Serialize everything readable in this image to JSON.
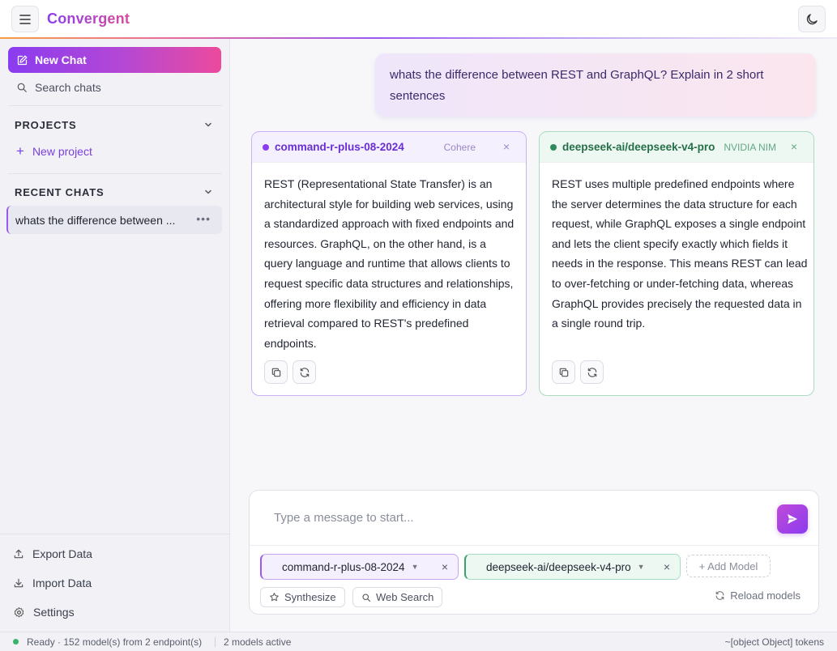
{
  "app": {
    "title": "Convergent"
  },
  "sidebar": {
    "new_chat": "New Chat",
    "search": "Search chats",
    "projects_title": "PROJECTS",
    "new_project": "New project",
    "recent_title": "RECENT CHATS",
    "recent_chats": [
      {
        "title": "whats the difference between ..."
      }
    ],
    "export": "Export Data",
    "import": "Import Data",
    "settings": "Settings"
  },
  "conversation": {
    "user_message": "whats the difference between REST and GraphQL? Explain in 2 short sentences",
    "responses": [
      {
        "model": "command-r-plus-08-2024",
        "provider": "Cohere",
        "color": "#8b3df0",
        "text": "REST (Representational State Transfer) is an architectural style for building web services, using a standardized approach with fixed endpoints and resources. GraphQL, on the other hand, is a query language and runtime that allows clients to request specific data structures and relationships, offering more flexibility and efficiency in data retrieval compared to REST's predefined endpoints."
      },
      {
        "model": "deepseek-ai/deepseek-v4-pro",
        "provider": "NVIDIA NIM",
        "color": "#2f8a5b",
        "text": "REST uses multiple predefined endpoints where the server determines the data structure for each request, while GraphQL exposes a single endpoint and lets the client specify exactly which fields it needs in the response. This means REST can lead to over-fetching or under-fetching data, whereas GraphQL provides precisely the requested data in a single round trip."
      }
    ]
  },
  "composer": {
    "placeholder": "Type a message to start...",
    "models": [
      {
        "name": "command-r-plus-08-2024"
      },
      {
        "name": "deepseek-ai/deepseek-v4-pro"
      }
    ],
    "add_model": "+ Add Model",
    "synthesize": "Synthesize",
    "web_search": "Web Search",
    "reload": "Reload models"
  },
  "status": {
    "ready": "Ready · 152 model(s) from 2 endpoint(s)",
    "active": "2 models active",
    "tokens": "~[object Object] tokens",
    "color": "#3bb36a"
  }
}
